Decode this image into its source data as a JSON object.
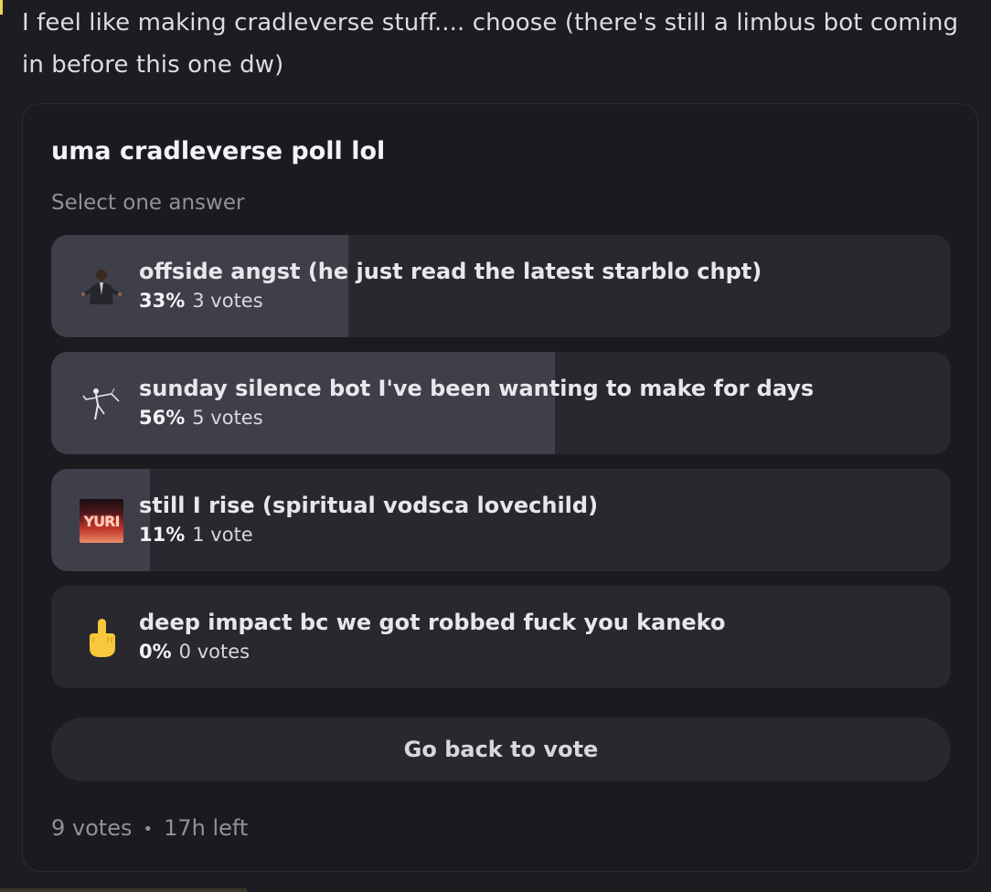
{
  "message": {
    "text": "I feel like making cradleverse stuff.... choose (there's still a limbus bot coming in before this one dw)"
  },
  "poll": {
    "question": "uma cradleverse poll lol",
    "instruction": "Select one answer",
    "answers": [
      {
        "label": "offside angst (he just read the latest starblo chpt)",
        "percent_label": "33%",
        "votes_label": "3 votes",
        "fraction": 0.33,
        "icon": "man-in-suit-emoji-icon"
      },
      {
        "label": "sunday silence bot I've been wanting to make for days",
        "percent_label": "56%",
        "votes_label": "5 votes",
        "fraction": 0.56,
        "icon": "skeletal-figure-emoji-icon"
      },
      {
        "label": "still I rise (spiritual vodsca lovechild)",
        "percent_label": "11%",
        "votes_label": "1 vote",
        "fraction": 0.11,
        "icon": "yuri-emoji-icon",
        "icon_text": "YURI"
      },
      {
        "label": "deep impact bc we got robbed fuck you kaneko",
        "percent_label": "0%",
        "votes_label": "0 votes",
        "fraction": 0.0,
        "icon": "middle-finger-emoji-icon"
      }
    ],
    "go_back_label": "Go back to vote",
    "total_votes": "9 votes",
    "separator": "•",
    "time_left": "17h left"
  },
  "colors": {
    "background": "#1c1c21",
    "card": "#1a1a1f",
    "answer_bg": "#28282e",
    "answer_fill": "#3f3f4a",
    "muted_text": "#8f929a"
  }
}
